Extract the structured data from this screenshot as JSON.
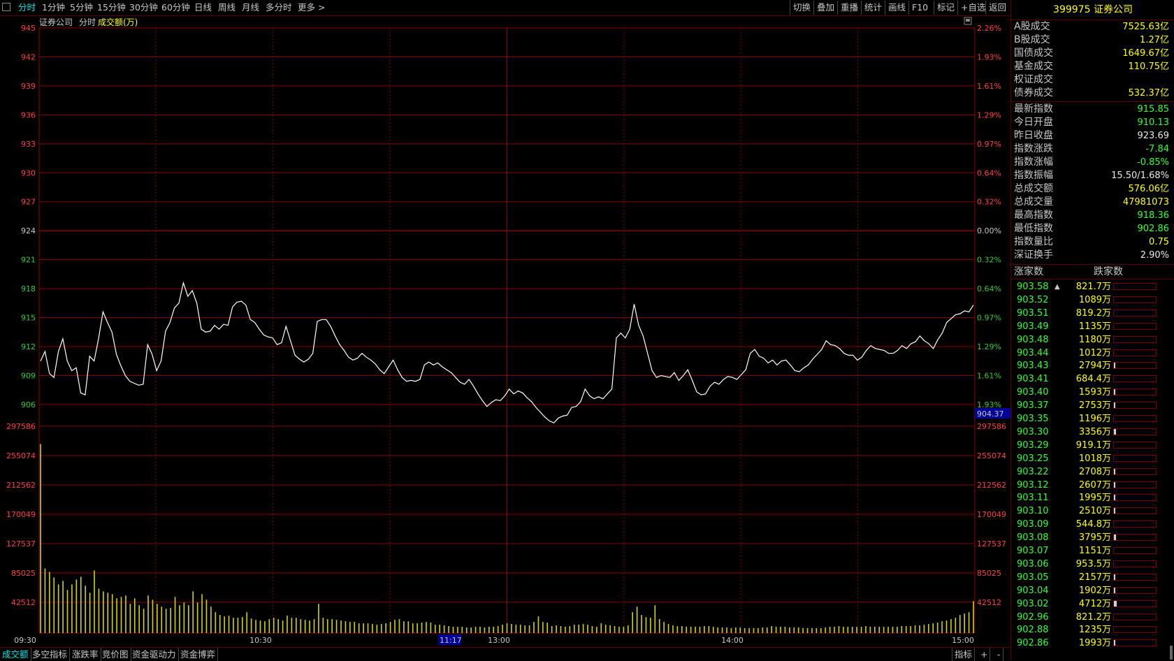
{
  "toolbar": {
    "periods": [
      "分时",
      "1分钟",
      "5分钟",
      "15分钟",
      "30分钟",
      "60分钟",
      "日线",
      "周线",
      "月线",
      "多分时",
      "更多"
    ],
    "actions": [
      "切换",
      "叠加",
      "重播",
      "统计",
      "画线",
      "F10",
      "标记",
      "+自选",
      "返回"
    ]
  },
  "chart": {
    "name": "证券公司",
    "period": "分时",
    "indicator": "成交额(万)",
    "price_ticks": [
      "945",
      "942",
      "939",
      "936",
      "933",
      "930",
      "927",
      "924",
      "921",
      "918",
      "915",
      "912",
      "909",
      "906"
    ],
    "pct_ticks": [
      "2.26%",
      "1.93%",
      "1.61%",
      "1.29%",
      "0.97%",
      "0.64%",
      "0.32%",
      "0.00%",
      "0.32%",
      "0.64%",
      "0.97%",
      "1.29%",
      "1.61%",
      "1.93%"
    ],
    "vol_ticks": [
      "297586",
      "255074",
      "212562",
      "170049",
      "127537",
      "85025",
      "42512"
    ],
    "time_labels": [
      "09:30",
      "10:30",
      "13:00",
      "14:00",
      "15:00"
    ],
    "cursor_time": "11:17",
    "cursor_price": "904.37",
    "colors": {
      "up": "#ff4040",
      "down": "#33cc33",
      "line": "#ffffff",
      "volume": "#d4d400",
      "grid": "#8a0000"
    },
    "chart_data": {
      "type": "line",
      "ylim": [
        905.5,
        945
      ],
      "prev_close": 924,
      "prices": [
        910.5,
        911.5,
        909.2,
        908.8,
        911.5,
        912.8,
        910.5,
        909.5,
        909.8,
        907.2,
        907,
        911,
        910.5,
        912.8,
        915.6,
        914.5,
        913.5,
        911.2,
        910,
        909,
        908.4,
        908.2,
        908,
        908.1,
        912.2,
        911.2,
        909.5,
        910.5,
        913.6,
        914.5,
        916,
        916.5,
        918.6,
        917.2,
        917.8,
        916.5,
        913.8,
        913.5,
        913.6,
        914.2,
        913.8,
        914.3,
        914.2,
        916.1,
        916.6,
        916.7,
        916.3,
        914.8,
        914.5,
        913.8,
        913.2,
        913,
        912.9,
        912.2,
        912.4,
        914.1,
        912.6,
        911.1,
        910.7,
        910.4,
        910.7,
        911.3,
        914.6,
        914.8,
        914.8,
        914.1,
        913.1,
        912.2,
        911.6,
        910.9,
        910.6,
        910.8,
        911.3,
        910.9,
        910.6,
        910.2,
        909.6,
        909.2,
        909.9,
        910.6,
        909.6,
        908.8,
        908.4,
        908.5,
        908.4,
        908.6,
        910.1,
        910.4,
        910.1,
        910.3,
        909.9,
        909.6,
        909.3,
        908.8,
        908.3,
        908.1,
        908.6,
        907.9,
        907.1,
        906.4,
        905.8,
        906.2,
        906.5,
        906.4,
        906.9,
        907.6,
        907.1,
        907.4,
        907.2,
        906.7,
        906.3,
        905.7,
        905.2,
        904.7,
        904.3,
        904.1,
        904.6,
        904.8,
        904.9,
        905.7,
        905.8,
        906.3,
        907.6,
        906.9,
        906.6,
        906.8,
        906.6,
        907.1,
        907.6,
        912.9,
        913.4,
        912.9,
        913.8,
        916.4,
        914.2,
        913.1,
        911.3,
        909.5,
        908.8,
        909,
        908.9,
        908.8,
        909.3,
        908.5,
        909,
        909.6,
        908.5,
        907.3,
        907,
        907.1,
        907.9,
        908.3,
        908.1,
        908.6,
        908.9,
        908.8,
        908.6,
        909.1,
        909.6,
        911.3,
        911.7,
        911,
        910.8,
        910.3,
        910.6,
        910.1,
        910.5,
        910.6,
        910.1,
        909.5,
        909.4,
        909.8,
        910.1,
        910.7,
        911.2,
        911.7,
        912.6,
        912.2,
        912.1,
        911.8,
        911.3,
        911.1,
        911.1,
        910.6,
        910.9,
        911.6,
        912.1,
        911.8,
        911.7,
        911.6,
        911.3,
        911.3,
        911.6,
        912.1,
        911.8,
        912.3,
        912.5,
        913.1,
        912.6,
        912.3,
        911.8,
        912.7,
        913.4,
        914.5,
        914.9,
        915.3,
        915.4,
        915.7,
        915.6,
        916.3
      ]
    },
    "volume_data": {
      "type": "bar",
      "ylim": [
        0,
        297586
      ],
      "values": [
        272000,
        93000,
        88000,
        80000,
        70000,
        75000,
        62000,
        70000,
        77000,
        81000,
        68000,
        58000,
        90000,
        64000,
        60000,
        58000,
        56000,
        50000,
        52000,
        54000,
        42000,
        50000,
        40000,
        35000,
        54000,
        48000,
        42000,
        38000,
        35000,
        36000,
        52000,
        40000,
        44000,
        40000,
        60000,
        44000,
        56000,
        48000,
        38000,
        30000,
        26000,
        24000,
        25000,
        22000,
        22000,
        23000,
        30000,
        21000,
        19000,
        18000,
        17000,
        20000,
        22000,
        20000,
        18000,
        25000,
        22000,
        22000,
        20000,
        19000,
        18000,
        20000,
        42000,
        22000,
        20000,
        20000,
        19000,
        18000,
        17000,
        16000,
        16000,
        14000,
        14000,
        14000,
        13000,
        12000,
        13000,
        14000,
        16000,
        19000,
        20000,
        17000,
        17000,
        14000,
        14000,
        15000,
        16000,
        15000,
        12000,
        12000,
        11000,
        10000,
        9000,
        9000,
        9000,
        8000,
        8000,
        9000,
        9000,
        8000,
        9000,
        9000,
        10000,
        12000,
        14000,
        13000,
        12000,
        12000,
        11000,
        11000,
        16000,
        24000,
        16000,
        15000,
        10000,
        11000,
        10000,
        9000,
        10000,
        12000,
        12000,
        13000,
        12000,
        10000,
        9000,
        14000,
        12000,
        11000,
        10000,
        9000,
        9000,
        11000,
        30000,
        38000,
        26000,
        23000,
        22000,
        40000,
        20000,
        16000,
        13000,
        11000,
        10000,
        10000,
        9000,
        9000,
        9000,
        9000,
        10000,
        10000,
        9000,
        8000,
        8000,
        8000,
        7000,
        8000,
        8000,
        7000,
        7000,
        7000,
        7000,
        8000,
        8000,
        10000,
        9000,
        9000,
        9000,
        8000,
        8000,
        8000,
        7000,
        7000,
        7000,
        7000,
        7000,
        8000,
        9000,
        9000,
        10000,
        9000,
        9000,
        9000,
        9000,
        9000,
        10000,
        9000,
        9000,
        9000,
        9000,
        9000,
        9000,
        9000,
        10000,
        10000,
        10000,
        11000,
        11000,
        12000,
        13000,
        14000,
        15000,
        17000,
        18000,
        20000,
        22000,
        26000,
        28000,
        30000,
        46000
      ]
    }
  },
  "sidebar": {
    "title": "399975 证券公司",
    "summary": [
      {
        "label": "A股成交",
        "value": "7525.63亿",
        "color": "cy"
      },
      {
        "label": "B股成交",
        "value": "1.27亿",
        "color": "cy"
      },
      {
        "label": "国债成交",
        "value": "1649.67亿",
        "color": "cy"
      },
      {
        "label": "基金成交",
        "value": "110.75亿",
        "color": "cy"
      },
      {
        "label": "权证成交",
        "value": "",
        "color": "cy"
      },
      {
        "label": "债券成交",
        "value": "532.37亿",
        "color": "cy"
      }
    ],
    "stats": [
      {
        "label": "最新指数",
        "value": "915.85",
        "color": "cg"
      },
      {
        "label": "今日开盘",
        "value": "910.13",
        "color": "cg"
      },
      {
        "label": "昨日收盘",
        "value": "923.69",
        "color": "cw"
      },
      {
        "label": "指数涨跌",
        "value": "-7.84",
        "color": "cg"
      },
      {
        "label": "指数涨幅",
        "value": "-0.85%",
        "color": "cg"
      },
      {
        "label": "指数振幅",
        "value": "15.50/1.68%",
        "color": "cw"
      },
      {
        "label": "总成交额",
        "value": "576.06亿",
        "color": "cy"
      },
      {
        "label": "总成交量",
        "value": "47981073",
        "color": "cy"
      },
      {
        "label": "最高指数",
        "value": "918.36",
        "color": "cg"
      },
      {
        "label": "最低指数",
        "value": "902.86",
        "color": "cg"
      },
      {
        "label": "指数量比",
        "value": "0.75",
        "color": "cy"
      },
      {
        "label": "深证换手",
        "value": "2.90%",
        "color": "cw"
      }
    ],
    "breadth": {
      "up_label": "涨家数",
      "down_label": "跌家数"
    },
    "ticks": [
      {
        "price": "903.58",
        "vol": "821.7万",
        "fill": 0,
        "up": true
      },
      {
        "price": "903.52",
        "vol": "1089万",
        "fill": 0
      },
      {
        "price": "903.51",
        "vol": "819.2万",
        "fill": 0
      },
      {
        "price": "903.49",
        "vol": "1135万",
        "fill": 0
      },
      {
        "price": "903.48",
        "vol": "1180万",
        "fill": 0
      },
      {
        "price": "903.44",
        "vol": "1012万",
        "fill": 0
      },
      {
        "price": "903.43",
        "vol": "2794万",
        "fill": 0.03
      },
      {
        "price": "903.41",
        "vol": "684.4万",
        "fill": 0
      },
      {
        "price": "903.40",
        "vol": "1593万",
        "fill": 0.01
      },
      {
        "price": "903.37",
        "vol": "2753万",
        "fill": 0.03
      },
      {
        "price": "903.35",
        "vol": "1196万",
        "fill": 0
      },
      {
        "price": "903.30",
        "vol": "3356万",
        "fill": 0.05
      },
      {
        "price": "903.29",
        "vol": "919.1万",
        "fill": 0
      },
      {
        "price": "903.25",
        "vol": "1018万",
        "fill": 0
      },
      {
        "price": "903.22",
        "vol": "2708万",
        "fill": 0.03
      },
      {
        "price": "903.12",
        "vol": "2607万",
        "fill": 0.03
      },
      {
        "price": "903.11",
        "vol": "1995万",
        "fill": 0.02
      },
      {
        "price": "903.10",
        "vol": "2510万",
        "fill": 0.03
      },
      {
        "price": "903.09",
        "vol": "544.8万",
        "fill": 0
      },
      {
        "price": "903.08",
        "vol": "3795万",
        "fill": 0.05
      },
      {
        "price": "903.07",
        "vol": "1151万",
        "fill": 0
      },
      {
        "price": "903.06",
        "vol": "953.5万",
        "fill": 0
      },
      {
        "price": "903.05",
        "vol": "2157万",
        "fill": 0.02
      },
      {
        "price": "903.04",
        "vol": "1902万",
        "fill": 0.02
      },
      {
        "price": "903.02",
        "vol": "4712万",
        "fill": 0.07
      },
      {
        "price": "902.96",
        "vol": "821.2万",
        "fill": 0
      },
      {
        "price": "902.88",
        "vol": "1235万",
        "fill": 0
      },
      {
        "price": "902.86",
        "vol": "1993万",
        "fill": 0.02
      }
    ]
  },
  "bottombar": {
    "tabs": [
      "成交额",
      "多空指标",
      "涨跌率",
      "竞价图",
      "资金驱动力",
      "资金博弈"
    ],
    "right": [
      "指标",
      "+",
      "-"
    ]
  }
}
